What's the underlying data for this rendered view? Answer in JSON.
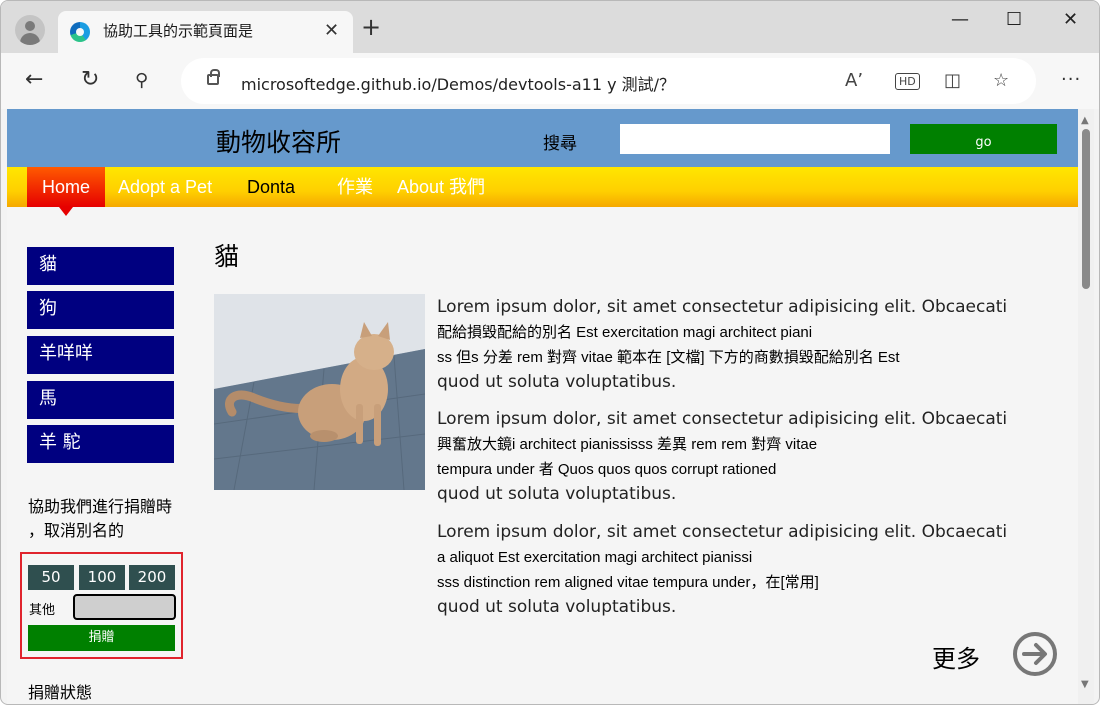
{
  "browser": {
    "tab_title": "協助工具的示範頁面是",
    "tab_close": "✕",
    "new_tab": "+",
    "url": "microsoftedge.github.io/Demos/devtools-a11 y 測試/？",
    "window_controls": {
      "minimize": "—",
      "maximize": "☐",
      "close": "✕"
    },
    "more_menu": "···"
  },
  "site": {
    "title": "動物收容所",
    "search_label": "搜尋",
    "search_value": "",
    "go_label": "go"
  },
  "nav": {
    "items": [
      {
        "label": "Home"
      },
      {
        "label": "Adopt a Pet"
      },
      {
        "label": "Donta"
      },
      {
        "label": "作業"
      },
      {
        "label": "About 我們"
      }
    ]
  },
  "sidebar": {
    "items": [
      {
        "label": "貓"
      },
      {
        "label": "狗"
      },
      {
        "label": "羊咩咩"
      },
      {
        "label": "馬"
      },
      {
        "label": "羊 駝"
      }
    ],
    "donate_text_1": "協助我們進行捐贈時",
    "donate_text_2": "，取消別名的",
    "amounts": [
      "50",
      "100",
      "200"
    ],
    "other_label": "其他",
    "other_value": "",
    "donate_button": "捐贈",
    "donate_status": "捐贈狀態"
  },
  "main": {
    "heading": "貓",
    "paragraphs": [
      {
        "l1": "Lorem ipsum dolor, sit amet consectetur adipisicing elit. Obcaecati",
        "l2": "配給損毀配給的別名 Est exercitation magi architect piani",
        "l3": "ss 但s 分差 rem 對齊 vitae 範本在 [文檔] 下方的商數損毀配給別名 Est",
        "l4": "quod ut soluta voluptatibus."
      },
      {
        "l1": "Lorem ipsum dolor, sit amet consectetur adipisicing elit. Obcaecati",
        "l2": "興奮放大鏡i architect pianississs 差異 rem rem 對齊 vitae",
        "l3": "tempura under 者 Quos quos quos corrupt rationed",
        "l4": "quod ut soluta voluptatibus."
      },
      {
        "l1": "Lorem ipsum dolor, sit amet consectetur adipisicing elit. Obcaecati",
        "l2": "a aliquot Est exercitation magi architect pianissi",
        "l3": "sss distinction rem aligned vitae tempura under，在[常用]",
        "l4": "quod ut soluta voluptatibus."
      }
    ],
    "more_label": "更多"
  },
  "colors": {
    "header_bg": "#6699cc",
    "nav_yellow": "#ffd800",
    "nav_home": "#e60000",
    "sidebar_button": "#000080",
    "go_button": "#008000",
    "amount_button": "#2f4f4f",
    "focus_outline": "#e0242d"
  },
  "icons": [
    "profile-icon",
    "edge-favicon",
    "back-icon",
    "refresh-icon",
    "search-icon",
    "lock-icon",
    "read-aloud-icon",
    "hd-icon",
    "immersive-reader-icon",
    "favorite-icon",
    "arrow-circle-right-icon"
  ]
}
